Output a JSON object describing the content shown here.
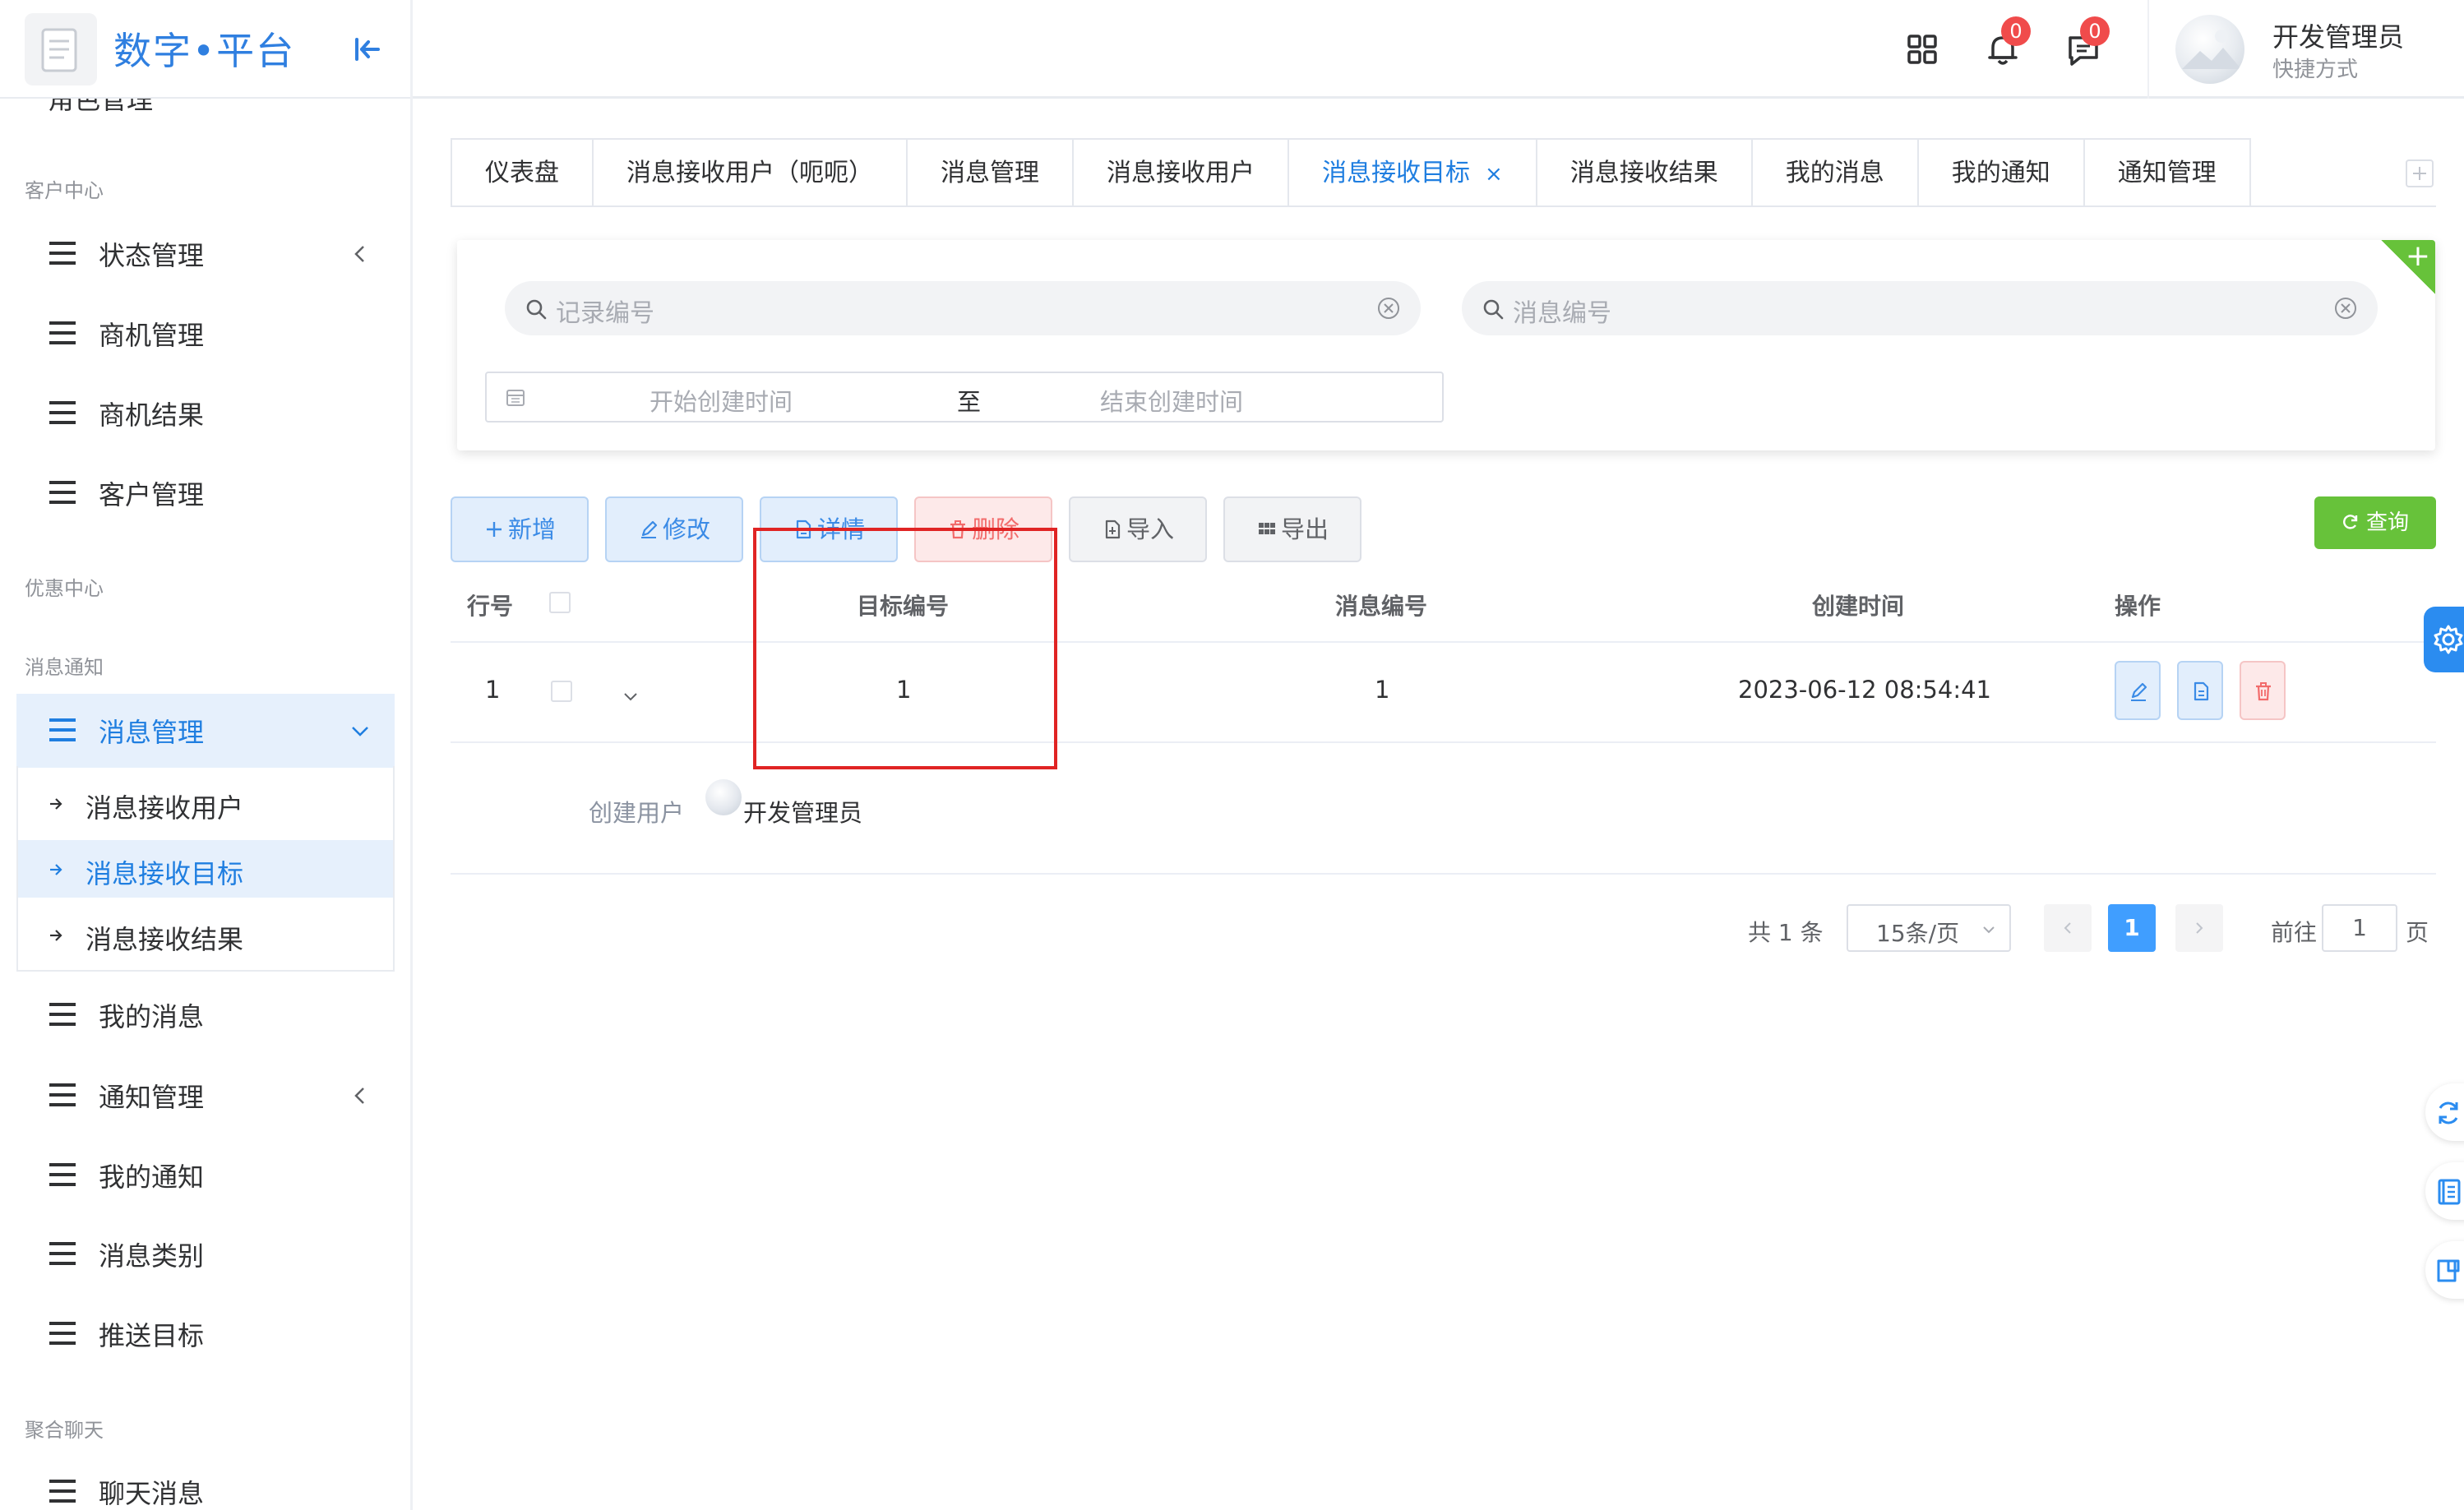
{
  "app": {
    "logo_text": "数字•平台"
  },
  "sidebar": {
    "clipped_item": "角色管理",
    "groups": [
      "客户中心",
      "优惠中心",
      "消息通知",
      "聚合聊天"
    ],
    "items": [
      {
        "label": "状态管理"
      },
      {
        "label": "商机管理"
      },
      {
        "label": "商机结果"
      },
      {
        "label": "客户管理"
      },
      {
        "label": "消息管理"
      },
      {
        "label": "我的消息"
      },
      {
        "label": "通知管理"
      },
      {
        "label": "我的通知"
      },
      {
        "label": "消息类别"
      },
      {
        "label": "推送目标"
      },
      {
        "label": "聊天消息"
      }
    ],
    "submenu": [
      {
        "label": "消息接收用户"
      },
      {
        "label": "消息接收目标"
      },
      {
        "label": "消息接收结果"
      }
    ]
  },
  "header": {
    "notification_count": "0",
    "message_count": "0",
    "user_name": "开发管理员",
    "user_sub": "快捷方式"
  },
  "tabs": [
    {
      "label": "仪表盘"
    },
    {
      "label": "消息接收用户（呃呃）"
    },
    {
      "label": "消息管理"
    },
    {
      "label": "消息接收用户"
    },
    {
      "label": "消息接收目标",
      "active": true
    },
    {
      "label": "消息接收结果"
    },
    {
      "label": "我的消息"
    },
    {
      "label": "我的通知"
    },
    {
      "label": "通知管理"
    }
  ],
  "tab_close": "×",
  "search": {
    "record_no_placeholder": "记录编号",
    "message_no_placeholder": "消息编号",
    "date_start_placeholder": "开始创建时间",
    "date_separator": "至",
    "date_end_placeholder": "结束创建时间"
  },
  "toolbar": {
    "add": "新增",
    "edit": "修改",
    "detail": "详情",
    "delete": "删除",
    "import": "导入",
    "export": "导出",
    "query": "查询"
  },
  "table": {
    "headers": {
      "row_no": "行号",
      "target_no": "目标编号",
      "message_no": "消息编号",
      "created_at": "创建时间",
      "actions": "操作"
    },
    "rows": [
      {
        "row_no": "1",
        "target_no": "1",
        "message_no": "1",
        "created_at": "2023-06-12 08:54:41"
      }
    ],
    "expanded": {
      "label": "创建用户",
      "user": "开发管理员"
    }
  },
  "pagination": {
    "total": "共 1 条",
    "page_size": "15条/页",
    "current_page": "1",
    "goto_label": "前往",
    "goto_value": "1",
    "page_suffix": "页"
  },
  "colors": {
    "primary": "#409eff",
    "success": "#67c23a",
    "danger": "#f56c6c",
    "highlight_box": "#e02424"
  }
}
